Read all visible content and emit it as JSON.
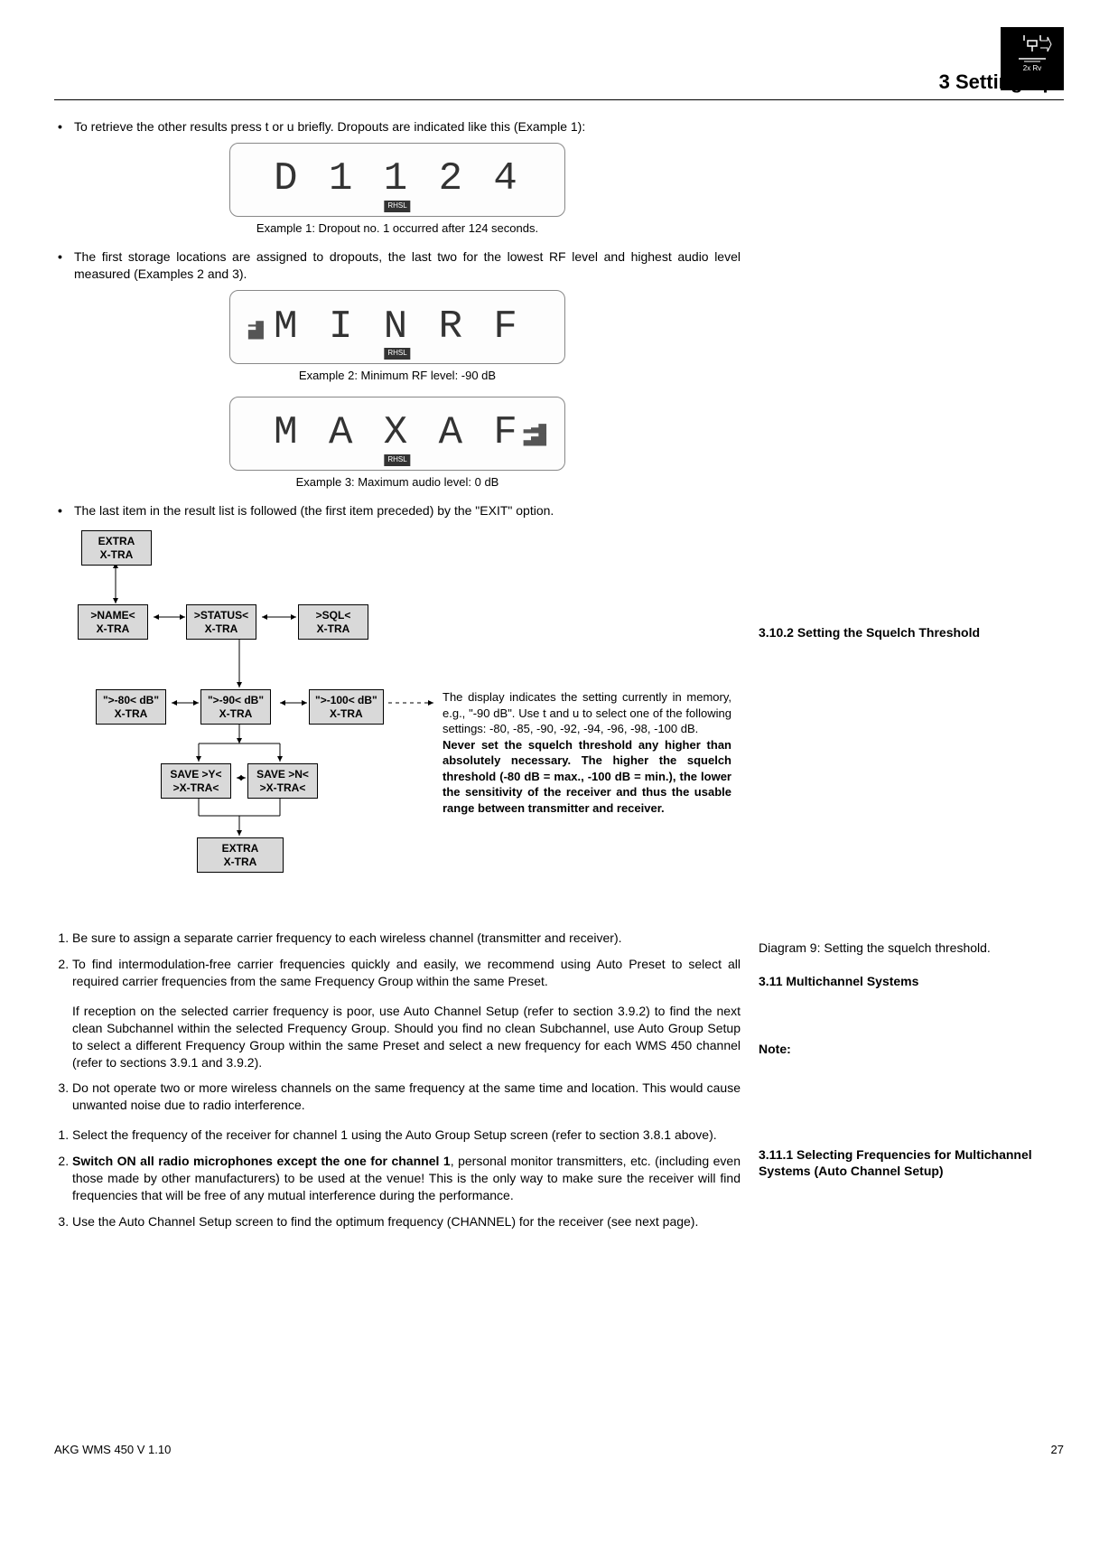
{
  "header": {
    "chapter": "3  Setting Up",
    "icon_label": "2x Rv"
  },
  "bullets_top": {
    "b1": "To retrieve the other results press t or u briefly. Dropouts are indicated like this (Example 1):",
    "b2": "The first storage locations are assigned to dropouts, the last two for the lowest RF level and highest audio level measured (Examples 2 and 3).",
    "b3": "The last item in the result list is followed (the first item preceded) by the \"EXIT\" option."
  },
  "lcd": {
    "d1": "D 1   1 2 4",
    "d2": "M I N   R F",
    "d3": "M A X   A F",
    "tag": "RHSL"
  },
  "captions": {
    "c1": "Example 1: Dropout no. 1 occurred after 124 seconds.",
    "c2": "Example 2: Minimum RF level: -90 dB",
    "c3": "Example 3: Maximum audio level: 0 dB"
  },
  "flow": {
    "extra_top1": "EXTRA",
    "extra_top2": "X-TRA",
    "name1": ">NAME<",
    "name2": "X-TRA",
    "status1": ">STATUS<",
    "status2": "X-TRA",
    "sql1": ">SQL<",
    "sql2": "X-TRA",
    "db80a": "\">-80< dB\"",
    "db80b": "X-TRA",
    "db90a": "\">-90< dB\"",
    "db90b": "X-TRA",
    "db100a": "\">-100< dB\"",
    "db100b": "X-TRA",
    "savey1": "SAVE >Y<",
    "savey2": ">X-TRA<",
    "saven1": "SAVE >N<",
    "saven2": ">X-TRA<",
    "extra_bot1": "EXTRA",
    "extra_bot2": "X-TRA"
  },
  "flow_desc": {
    "p1": "The display indicates the setting currently in memory, e.g., \"-90 dB\". Use t and u to select one of the following settings: -80, -85, -90, -92, -94, -96, -98, -100 dB.",
    "p2": "Never set the squelch threshold any higher than absolutely necessary. The higher the squelch threshold (-80 dB = max., -100 dB = min.), the lower the sensitivity of the receiver and thus the usable range between transmitter and receiver."
  },
  "sections": {
    "s3102": "3.10.2 Setting the Squelch Threshold",
    "diagram9": "Diagram 9: Setting the squelch threshold.",
    "s311": "3.11 Multichannel Systems",
    "note_label": "Note:",
    "s3111": "3.11.1 Selecting Frequencies for Multichannel Systems (Auto Channel Setup)"
  },
  "list311": {
    "i1": "Be sure to assign a separate carrier frequency to each wireless channel (transmitter and receiver).",
    "i2": "To find intermodulation-free carrier frequencies quickly and easily, we recommend using Auto Preset to select all required carrier frequencies from the same Frequency Group within the same Preset.",
    "note": "If reception on the selected carrier frequency is poor, use Auto Channel Setup (refer to section 3.9.2) to find the next clean Subchannel within the selected Frequency Group. Should you find no clean Subchannel, use Auto Group Setup to select a different Frequency Group within the same Preset and select a new frequency for each WMS 450 channel (refer to sections 3.9.1 and 3.9.2).",
    "i3": "Do not operate two or more wireless channels on the same frequency at the same time and location. This would cause unwanted noise due to radio interference."
  },
  "list3111": {
    "i1": "Select the frequency of the receiver for channel 1 using the Auto Group Setup screen (refer to section 3.8.1 above).",
    "i2a": "Switch ON all radio microphones except the one for channel 1",
    "i2b": ", personal monitor transmitters, etc. (including even those made by other manufacturers) to be used at the venue! This is the only way to make sure the receiver will find frequencies that will be free of any mutual interference during the performance.",
    "i3": "Use the Auto Channel Setup screen to find the optimum frequency (CHANNEL) for the receiver (see next page)."
  },
  "footer": {
    "left": "AKG WMS 450 V 1.10",
    "right": "27"
  }
}
